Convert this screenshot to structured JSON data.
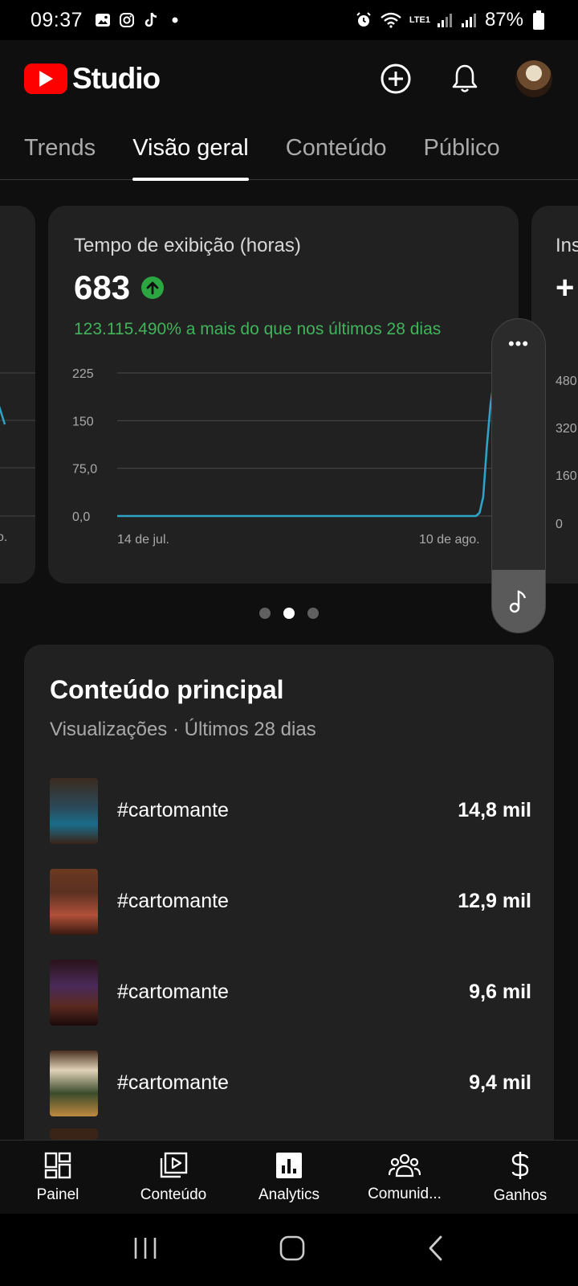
{
  "status_bar": {
    "time": "09:37",
    "battery": "87%",
    "network": "LTE1"
  },
  "header": {
    "app_name": "Studio",
    "brand_color": "#ff0000"
  },
  "tabs": [
    {
      "label": "Trends",
      "active": false
    },
    {
      "label": "Visão geral",
      "active": true
    },
    {
      "label": "Conteúdo",
      "active": false
    },
    {
      "label": "Público",
      "active": false
    }
  ],
  "left_card": {
    "tick_label": "o."
  },
  "main_card": {
    "title": "Tempo de exibição (horas)",
    "value": "683",
    "delta_text": "123.115.490% a mais do que nos últimos 28 dias",
    "delta_color": "#41b35a",
    "line_color": "#2ea3c7"
  },
  "right_card": {
    "title": "Ins",
    "value": "+",
    "ticks": [
      "480",
      "320",
      "160",
      "0"
    ]
  },
  "chart_data": {
    "type": "line",
    "x_tick_labels": [
      "14 de jul.",
      "10 de ago."
    ],
    "y_tick_labels": [
      "225",
      "150",
      "75,0",
      "0,0"
    ],
    "ylim": [
      0,
      225
    ],
    "series": [
      {
        "values": [
          0,
          0,
          0,
          0,
          0,
          0,
          0,
          0,
          0,
          0,
          0,
          0,
          0,
          0,
          0,
          0,
          0,
          0,
          0,
          0,
          0,
          0,
          0,
          0,
          0,
          0,
          0,
          0,
          0,
          0,
          0,
          0,
          0,
          0,
          0,
          0,
          0,
          0,
          0,
          0,
          0,
          0,
          0,
          0,
          0,
          0,
          0,
          0,
          0,
          0,
          0,
          0,
          0,
          0,
          0,
          0,
          0,
          0,
          0,
          0,
          0,
          0,
          0,
          0,
          0,
          0,
          0,
          0,
          0,
          0,
          0,
          0,
          0,
          0,
          0,
          0,
          0,
          0,
          0,
          0,
          0,
          0,
          0,
          0,
          0,
          0,
          0,
          0,
          0,
          0,
          0,
          0,
          0,
          0,
          0,
          0,
          0,
          0,
          0,
          0,
          5,
          30,
          110,
          175,
          215,
          150
        ]
      }
    ]
  },
  "carousel": {
    "page_count": 3,
    "active_index": 1
  },
  "float_widget": {
    "more_label": "•••"
  },
  "top_content": {
    "title": "Conteúdo principal",
    "subtitle": "Visualizações · Últimos 28 dias",
    "items": [
      {
        "label": "#cartomante",
        "value": "14,8 mil"
      },
      {
        "label": "#cartomante",
        "value": "12,9 mil"
      },
      {
        "label": "#cartomante",
        "value": "9,6 mil"
      },
      {
        "label": "#cartomante",
        "value": "9,4 mil"
      }
    ]
  },
  "bottom_nav": [
    {
      "label": "Painel",
      "icon": "dashboard-icon"
    },
    {
      "label": "Conteúdo",
      "icon": "content-icon"
    },
    {
      "label": "Analytics",
      "icon": "analytics-icon",
      "active": true
    },
    {
      "label": "Comunid...",
      "icon": "community-icon"
    },
    {
      "label": "Ganhos",
      "icon": "dollar-icon"
    }
  ]
}
